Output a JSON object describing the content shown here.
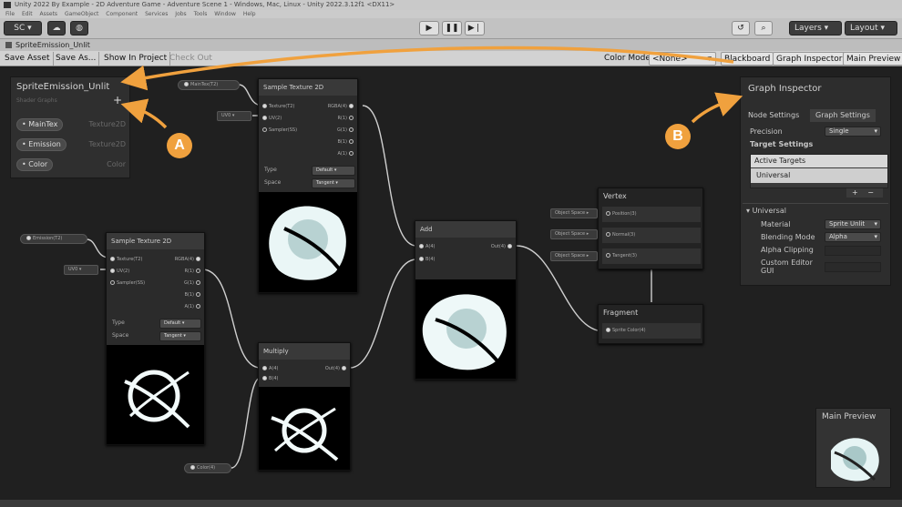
{
  "window": {
    "title": "Unity 2022 By Example - 2D Adventure Game - Adventure Scene 1 - Windows, Mac, Linux - Unity 2022.3.12f1 <DX11>",
    "menu": [
      "File",
      "Edit",
      "Assets",
      "GameObject",
      "Component",
      "Services",
      "Jobs",
      "Tools",
      "Window",
      "Help"
    ]
  },
  "toolbar": {
    "account": "SC",
    "layers": "Layers",
    "layout": "Layout"
  },
  "tab": {
    "label": "SpriteEmission_Unlit"
  },
  "sg_toolbar": {
    "save_asset": "Save Asset",
    "save_as": "Save As...",
    "show_in_project": "Show In Project",
    "check_out": "Check Out",
    "color_mode_label": "Color Mode",
    "color_mode_value": "<None>",
    "blackboard": "Blackboard",
    "graph_inspector": "Graph Inspector",
    "main_preview": "Main Preview"
  },
  "blackboard": {
    "title": "SpriteEmission_Unlit",
    "subtitle": "Shader Graphs",
    "properties": [
      {
        "name": "MainTex",
        "type": "Texture2D"
      },
      {
        "name": "Emission",
        "type": "Texture2D"
      },
      {
        "name": "Color",
        "type": "Color"
      }
    ]
  },
  "graph_inspector": {
    "title": "Graph Inspector",
    "tab_node": "Node Settings",
    "tab_graph": "Graph Settings",
    "precision_label": "Precision",
    "precision_value": "Single",
    "target_settings": "Target Settings",
    "active_targets": "Active Targets",
    "target_universal": "Universal",
    "section_universal": "Universal",
    "material_label": "Material",
    "material_value": "Sprite Unlit",
    "blending_label": "Blending Mode",
    "blending_value": "Alpha",
    "alpha_clip_label": "Alpha Clipping",
    "custom_gui_label": "Custom Editor GUI"
  },
  "nodes": {
    "sample_tex_1": {
      "title": "Sample Texture 2D",
      "inputs": [
        "Texture(T2)",
        "UV(2)",
        "Sampler(SS)"
      ],
      "outputs": [
        "RGBA(4)",
        "R(1)",
        "G(1)",
        "B(1)",
        "A(1)"
      ],
      "type_label": "Type",
      "type_value": "Default",
      "space_label": "Space",
      "space_value": "Tangent"
    },
    "sample_tex_2": {
      "title": "Sample Texture 2D",
      "inputs": [
        "Texture(T2)",
        "UV(2)",
        "Sampler(SS)"
      ],
      "outputs": [
        "RGBA(4)",
        "R(1)",
        "G(1)",
        "B(1)",
        "A(1)"
      ],
      "type_label": "Type",
      "type_value": "Default",
      "space_label": "Space",
      "space_value": "Tangent"
    },
    "add": {
      "title": "Add",
      "inputs": [
        "A(4)",
        "B(4)"
      ],
      "output": "Out(4)"
    },
    "multiply": {
      "title": "Multiply",
      "inputs": [
        "A(4)",
        "B(4)"
      ],
      "output": "Out(4)"
    },
    "vertex": {
      "title": "Vertex",
      "ports": [
        "Position(3)",
        "Normal(3)",
        "Tangent(3)"
      ],
      "space": "Object Space"
    },
    "fragment": {
      "title": "Fragment",
      "ports": [
        "Sprite Color(4)"
      ]
    }
  },
  "pills": {
    "maintex": "MainTex(T2)",
    "emission": "Emission(T2)",
    "color": "Color(4)",
    "uv0": "UV0"
  },
  "main_preview": {
    "title": "Main Preview"
  },
  "callouts": {
    "a": "A",
    "b": "B"
  },
  "colors": {
    "accent": "#f0a13e",
    "graph_bg": "#202020",
    "node_bg": "#2b2b2b"
  }
}
